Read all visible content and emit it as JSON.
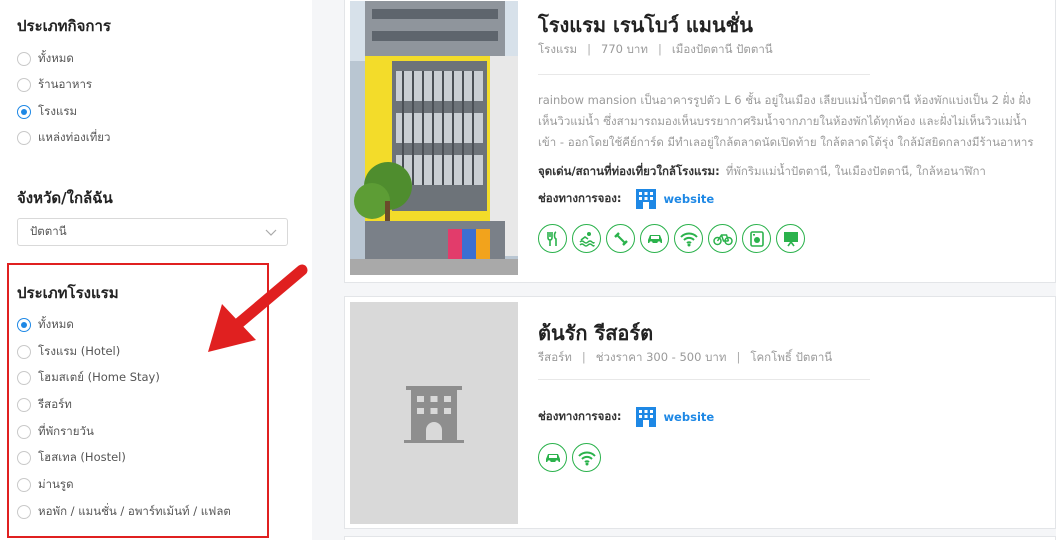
{
  "sidebar": {
    "business_type": {
      "title": "ประเภทกิจการ",
      "options": [
        "ทั้งหมด",
        "ร้านอาหาร",
        "โรงแรม",
        "แหล่งท่องเที่ยว"
      ],
      "selected_index": 2
    },
    "province": {
      "title": "จังหวัด/ใกล้ฉัน",
      "selected": "ปัตตานี"
    },
    "hotel_type": {
      "title": "ประเภทโรงแรม",
      "options": [
        "ทั้งหมด",
        "โรงแรม (Hotel)",
        "โฮมสเตย์ (Home Stay)",
        "รีสอร์ท",
        "ที่พักรายวัน",
        "โฮสเทล (Hostel)",
        "ม่านรูด",
        "หอพัก / แมนชั่น / อพาร์ทเม้นท์ / แฟลต"
      ],
      "selected_index": 0
    }
  },
  "listings": [
    {
      "name": "โรงแรม เรนโบว์ แมนชั่น",
      "category": "โรงแรม",
      "price": "770 บาท",
      "location": "เมืองปัตตานี ปัตตานี",
      "description": "rainbow mansion เป็นอาคารรูปตัว L 6 ชั้น อยู่ในเมือง เลียบแม่น้ำปัตตานี ห้องพักแบ่งเป็น 2 ฝั่ง ฝั่งเห็นวิวแม่น้ำ ซึ่งสามารถมองเห็นบรรยากาศริมน้ำจากภายในห้องพักได้ทุกห้อง และฝั่งไม่เห็นวิวแม่น้ำ เข้า - ออกโดยใช้คีย์การ์ด มีทำเลอยู่ใกล้ตลาดนัดเปิดท้าย ใกล้ตลาดโต้รุ่ง ใกล้มัสยิดกลางมีร้านอาหาร",
      "nearby_label": "จุดเด่น/สถานที่ท่องเที่ยวใกล้โรงแรม:",
      "nearby": "ที่พักริมแม่น้ำปัตตานี, ในเมืองปัตตานี, ใกล้หอนาฬิกา",
      "booking_label": "ช่องทางการจอง:",
      "booking_link": "website",
      "amenities": [
        "restaurant-icon",
        "pool-icon",
        "fitness-icon",
        "parking-icon",
        "wifi-icon",
        "bicycle-icon",
        "laundry-icon",
        "meeting-room-icon"
      ]
    },
    {
      "name": "ต้นรัก รีสอร์ต",
      "category": "รีสอร์ท",
      "price": "ช่วงราคา 300 - 500 บาท",
      "location": "โคกโพธิ์ ปัตตานี",
      "booking_label": "ช่องทางการจอง:",
      "booking_link": "website",
      "amenities": [
        "parking-icon",
        "wifi-icon"
      ]
    }
  ],
  "colors": {
    "accent_blue": "#1e88e5",
    "amenity_green": "#2bb24c",
    "annotation_red": "#e02020"
  }
}
